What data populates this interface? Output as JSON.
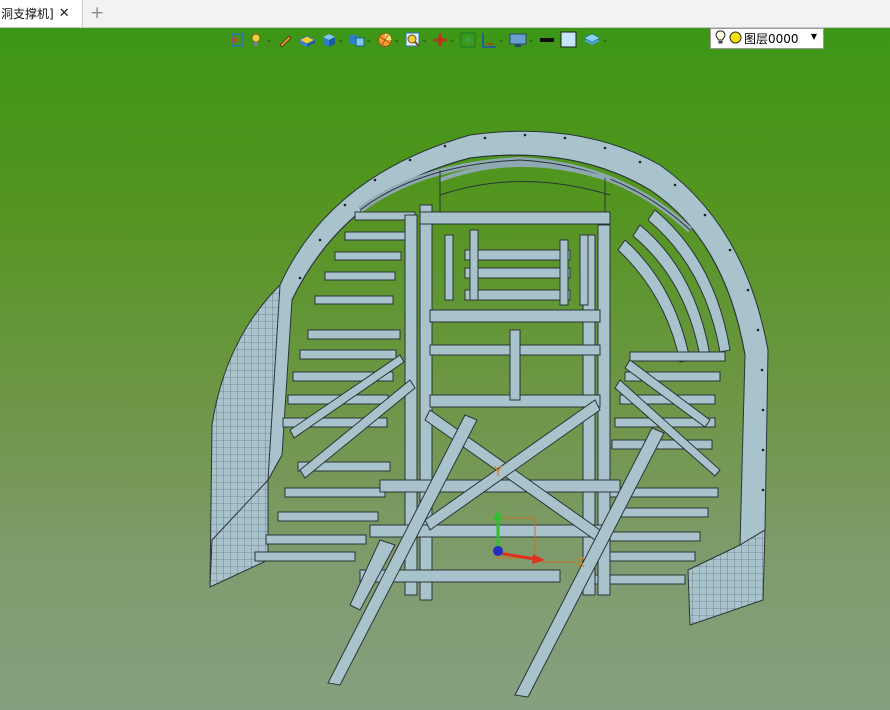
{
  "tab": {
    "title": "洞支撑机]",
    "close_glyph": "✕",
    "new_tab_glyph": "+"
  },
  "toolbar": {
    "buttons": [
      {
        "icon": "exit-icon",
        "dropdown": false
      },
      {
        "icon": "light-bulb-pointer-icon",
        "dropdown": true
      },
      {
        "icon": "pen-icon",
        "dropdown": false
      },
      {
        "icon": "flat-solid-icon",
        "dropdown": false
      },
      {
        "icon": "cube-icon",
        "dropdown": true
      },
      {
        "icon": "multi-cube-icon",
        "dropdown": true
      },
      {
        "icon": "section-pie-icon",
        "dropdown": true
      },
      {
        "icon": "zoom-icon",
        "dropdown": true
      },
      {
        "icon": "pan-icon",
        "dropdown": true
      },
      {
        "icon": "fit-view-icon",
        "dropdown": false
      },
      {
        "icon": "dimension-icon",
        "dropdown": true
      },
      {
        "icon": "display-monitor-icon",
        "dropdown": true
      },
      {
        "icon": "line-color-icon",
        "dropdown": false
      },
      {
        "icon": "fill-color-icon",
        "dropdown": false
      },
      {
        "icon": "layer-stack-icon",
        "dropdown": true
      }
    ],
    "layer": {
      "name": "图层0000",
      "bulb_icon": "bulb-icon",
      "state_color": "#f4e200"
    }
  },
  "viewport": {
    "axes": {
      "y_label": "Y",
      "x_label": "X"
    },
    "colors": {
      "background_top": "#3d9616",
      "background_bottom": "#85a07e",
      "model_fill": "#a9c3cd",
      "model_edge": "#2a3438"
    }
  }
}
